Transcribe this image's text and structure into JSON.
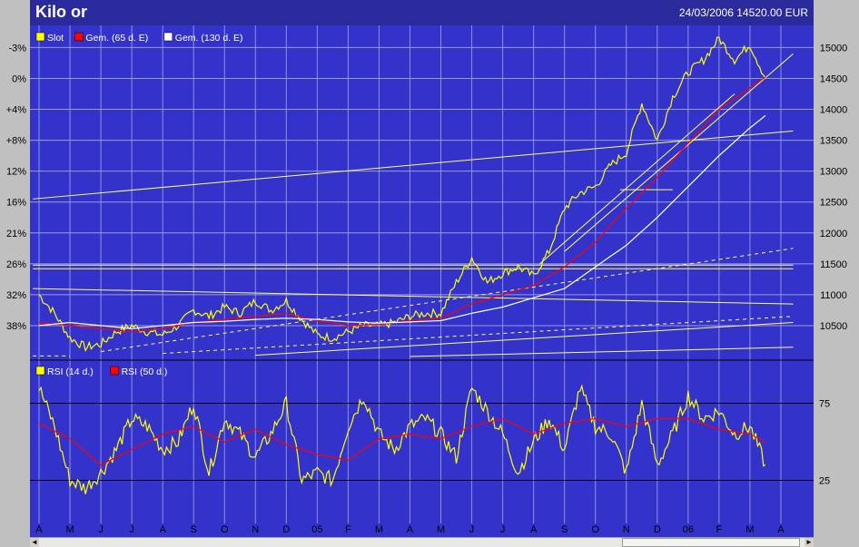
{
  "header": {
    "title": "Kilo or",
    "date": "24/03/2006",
    "price": "14520.00",
    "currency": "EUR"
  },
  "colors": {
    "plot_bg": "#3333cc",
    "frame": "#2a2a9c",
    "price_line": "#ffff00",
    "ma65": "#ff0000",
    "ma130": "#ffffff",
    "grid": "#9a9ae6"
  },
  "chart_data": [
    {
      "type": "line",
      "title": "Kilo or",
      "legend": [
        "Slot",
        "Gem. (65 d. E)",
        "Gem. (130 d. E)"
      ],
      "legend_placement": "top-left",
      "y_right_ticks": [
        15000,
        14500,
        14000,
        13500,
        13000,
        12500,
        12000,
        11500,
        11000,
        10500
      ],
      "y_left_ticks": [
        "-3%",
        "0%",
        "+4%",
        "+8%",
        "12%",
        "16%",
        "21%",
        "26%",
        "32%",
        "38%"
      ],
      "ylim": [
        10000,
        15300
      ],
      "x_labels": [
        "A",
        "M",
        "J",
        "J",
        "A",
        "S",
        "O",
        "N",
        "D",
        "05",
        "F",
        "M",
        "A",
        "M",
        "J",
        "J",
        "A",
        "S",
        "O",
        "N",
        "D",
        "06",
        "F",
        "M",
        "A"
      ],
      "grid": true,
      "series": [
        {
          "name": "Slot",
          "x": [
            0,
            0.5,
            1,
            1.5,
            2,
            2.5,
            3,
            3.5,
            4,
            4.5,
            5,
            5.5,
            6,
            6.5,
            7,
            7.5,
            8,
            8.5,
            9,
            9.5,
            10,
            10.5,
            11,
            11.5,
            12,
            12.5,
            13,
            13.5,
            14,
            14.5,
            15,
            15.5,
            16,
            16.5,
            17,
            17.5,
            18,
            18.5,
            19,
            19.5,
            20,
            20.5,
            21,
            21.5,
            22,
            22.5,
            23,
            23.5
          ],
          "values": [
            11000,
            10700,
            10300,
            10150,
            10200,
            10400,
            10500,
            10400,
            10350,
            10500,
            10750,
            10650,
            10800,
            10700,
            10900,
            10750,
            10900,
            10600,
            10350,
            10300,
            10400,
            10500,
            10500,
            10550,
            10650,
            10700,
            10700,
            11200,
            11600,
            11200,
            11350,
            11450,
            11300,
            11700,
            12400,
            12650,
            12750,
            13100,
            13300,
            14100,
            13500,
            14200,
            14600,
            14800,
            15150,
            14800,
            15050,
            14500
          ]
        },
        {
          "name": "Gem. (65 d. E)",
          "x": [
            0,
            1,
            2,
            3,
            4,
            5,
            6,
            7,
            8,
            9,
            10,
            11,
            12,
            13,
            14,
            15,
            16,
            17,
            18,
            19,
            20,
            21,
            22,
            23,
            23.5
          ],
          "values": [
            10550,
            10500,
            10450,
            10400,
            10450,
            10550,
            10600,
            10650,
            10700,
            10580,
            10500,
            10520,
            10580,
            10620,
            10850,
            11000,
            11150,
            11450,
            11850,
            12400,
            12900,
            13450,
            14000,
            14350,
            14520
          ]
        },
        {
          "name": "Gem. (130 d. E)",
          "x": [
            0,
            1,
            2,
            3,
            4,
            5,
            6,
            7,
            8,
            9,
            10,
            11,
            12,
            13,
            14,
            15,
            16,
            17,
            18,
            19,
            20,
            21,
            22,
            23,
            23.5
          ],
          "values": [
            10500,
            10550,
            10500,
            10450,
            10500,
            10550,
            10570,
            10600,
            10620,
            10600,
            10560,
            10540,
            10560,
            10580,
            10700,
            10800,
            10950,
            11100,
            11450,
            11800,
            12250,
            12750,
            13250,
            13700,
            13900
          ]
        }
      ]
    },
    {
      "type": "line",
      "legend": [
        "RSI (14 d.)",
        "RSI (50 d.)"
      ],
      "legend_placement": "top-left",
      "y_right_ticks": [
        75,
        25
      ],
      "ylim": [
        0,
        100
      ],
      "x_labels": [
        "A",
        "M",
        "J",
        "J",
        "A",
        "S",
        "O",
        "N",
        "D",
        "05",
        "F",
        "M",
        "A",
        "M",
        "J",
        "J",
        "A",
        "S",
        "O",
        "N",
        "D",
        "06",
        "F",
        "M",
        "A"
      ],
      "grid": true,
      "series": [
        {
          "name": "RSI (14 d.)",
          "x": [
            0,
            0.5,
            1,
            1.5,
            2,
            2.5,
            3,
            3.5,
            4,
            4.5,
            5,
            5.5,
            6,
            6.5,
            7,
            7.5,
            8,
            8.5,
            9,
            9.5,
            10,
            10.5,
            11,
            11.5,
            12,
            12.5,
            13,
            13.5,
            14,
            14.5,
            15,
            15.5,
            16,
            16.5,
            17,
            17.5,
            18,
            18.5,
            19,
            19.5,
            20,
            20.5,
            21,
            21.5,
            22,
            22.5,
            23,
            23.5
          ],
          "values": [
            85,
            60,
            25,
            20,
            30,
            45,
            65,
            60,
            45,
            50,
            75,
            30,
            65,
            55,
            40,
            55,
            75,
            25,
            30,
            25,
            60,
            80,
            55,
            45,
            60,
            65,
            55,
            40,
            85,
            70,
            55,
            30,
            50,
            65,
            45,
            85,
            60,
            55,
            30,
            75,
            35,
            55,
            80,
            65,
            70,
            55,
            60,
            35
          ]
        },
        {
          "name": "RSI (50 d.)",
          "x": [
            0,
            1,
            2,
            3,
            4,
            5,
            6,
            7,
            8,
            9,
            10,
            11,
            12,
            13,
            14,
            15,
            16,
            17,
            18,
            19,
            20,
            21,
            22,
            23,
            23.5
          ],
          "values": [
            62,
            52,
            35,
            45,
            55,
            60,
            50,
            58,
            48,
            42,
            38,
            52,
            55,
            52,
            60,
            65,
            55,
            62,
            65,
            60,
            65,
            65,
            58,
            55,
            50
          ]
        }
      ]
    }
  ],
  "scrollbar": {
    "left_arrow": "◄",
    "right_arrow": "►"
  }
}
